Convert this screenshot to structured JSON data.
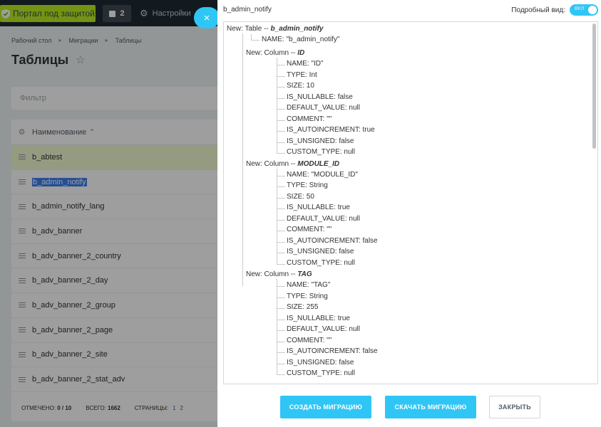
{
  "background": {
    "portal_label": "Портал под защитой",
    "notify_count": "2",
    "settings_label": "Настройки",
    "close_label": "×",
    "breadcrumb": [
      "Рабочий стол",
      "Миграции",
      "Таблицы"
    ],
    "breadcrumb_sep": "▸",
    "page_title": "Таблицы",
    "filter_placeholder": "Фильтр",
    "grid_header": "Наименование",
    "grid_header_sort": "⌃",
    "rows": [
      "b_abtest",
      "b_admin_notify",
      "b_admin_notify_lang",
      "b_adv_banner",
      "b_adv_banner_2_country",
      "b_adv_banner_2_day",
      "b_adv_banner_2_group",
      "b_adv_banner_2_page",
      "b_adv_banner_2_site",
      "b_adv_banner_2_stat_adv"
    ],
    "footer": {
      "selected_label": "ОТМЕЧЕНО:",
      "selected_value": "0 / 10",
      "total_label": "ВСЕГО:",
      "total_value": "1662",
      "pages_label": "СТРАНИЦЫ:",
      "page1": "1",
      "page2": "2"
    }
  },
  "panel": {
    "title": "b_admin_notify",
    "detail_label": "Подробный вид:",
    "toggle_text": "ВКЛ",
    "tree": {
      "table_prefix": "New: Table -- ",
      "table_name": "b_admin_notify",
      "table_name_attr": "NAME: \"b_admin_notify\"",
      "column_prefix": "New: Column -- ",
      "columns": [
        {
          "name": "ID",
          "attrs": [
            "NAME: \"ID\"",
            "TYPE: Int",
            "SIZE: 10",
            "IS_NULLABLE: false",
            "DEFAULT_VALUE: null",
            "COMMENT: \"\"",
            "IS_AUTOINCREMENT: true",
            "IS_UNSIGNED: false",
            "CUSTOM_TYPE: null"
          ]
        },
        {
          "name": "MODULE_ID",
          "attrs": [
            "NAME: \"MODULE_ID\"",
            "TYPE: String",
            "SIZE: 50",
            "IS_NULLABLE: true",
            "DEFAULT_VALUE: null",
            "COMMENT: \"\"",
            "IS_AUTOINCREMENT: false",
            "IS_UNSIGNED: false",
            "CUSTOM_TYPE: null"
          ]
        },
        {
          "name": "TAG",
          "attrs": [
            "NAME: \"TAG\"",
            "TYPE: String",
            "SIZE: 255",
            "IS_NULLABLE: true",
            "DEFAULT_VALUE: null",
            "COMMENT: \"\"",
            "IS_AUTOINCREMENT: false",
            "IS_UNSIGNED: false",
            "CUSTOM_TYPE: null"
          ]
        }
      ]
    },
    "buttons": {
      "create": "СОЗДАТЬ МИГРАЦИЮ",
      "download": "СКАЧАТЬ МИГРАЦИЮ",
      "close": "ЗАКРЫТЬ"
    }
  },
  "colors": {
    "accent": "#2fc6f6",
    "portal_green": "#bbed21",
    "topbar": "#1f2a33",
    "selection": "#3a7ff0"
  }
}
